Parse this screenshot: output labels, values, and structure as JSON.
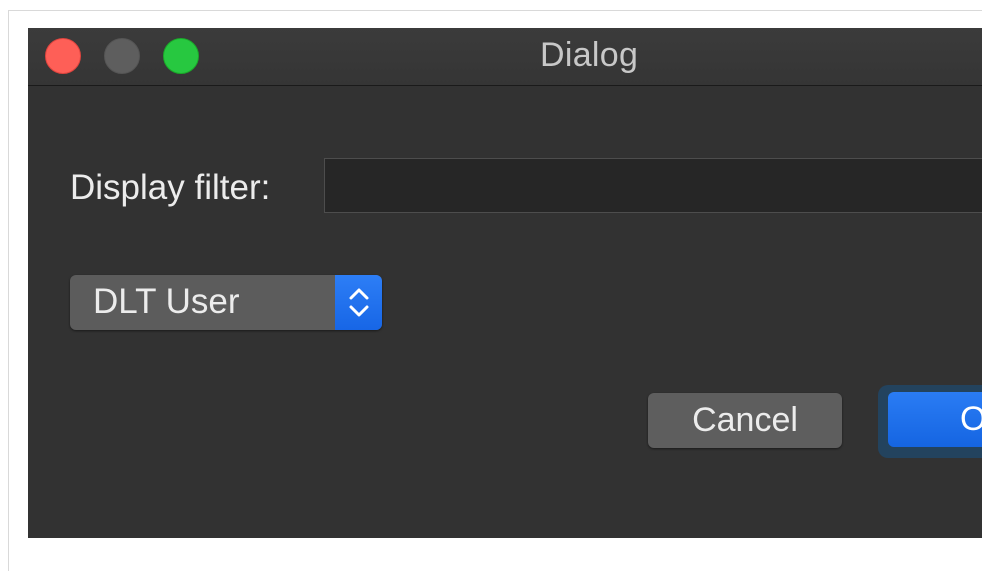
{
  "window": {
    "title": "Dialog"
  },
  "form": {
    "filter_label": "Display filter:",
    "filter_value": "",
    "filter_placeholder": ""
  },
  "selector": {
    "selected": "DLT User"
  },
  "buttons": {
    "cancel_label": "Cancel",
    "ok_label": "O"
  },
  "colors": {
    "window_bg": "#323232",
    "accent": "#1f6ff0",
    "close": "#fe5f57",
    "maximize": "#27c840"
  },
  "icons": {
    "stepper": "chevron-up-down-icon"
  }
}
